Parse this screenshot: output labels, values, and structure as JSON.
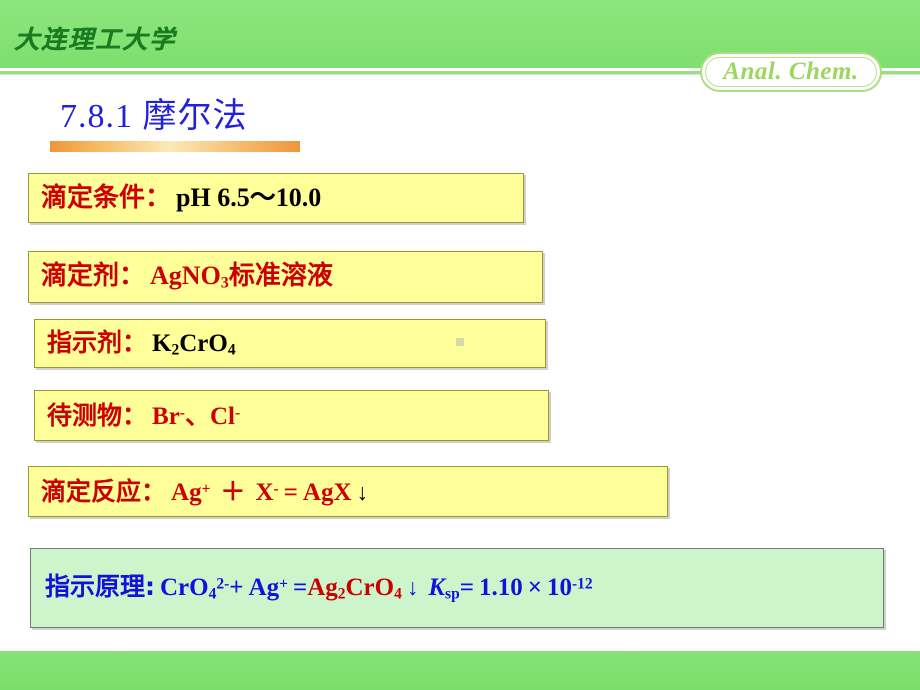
{
  "header": {
    "university_logo": "大连理工大学",
    "course_badge": "Anal. Chem.",
    "band_color": "#82e072",
    "logo_color": "#1a7a1f",
    "badge_color": "#9bd75f"
  },
  "title": {
    "number": "7.8.1",
    "text": "摩尔法",
    "full": "7.8.1 摩尔法",
    "color": "#2222d8",
    "underline_color": "#f0943c"
  },
  "boxes": [
    {
      "id": "titration-condition",
      "label": "滴定条件：",
      "label_color": "#cc0000",
      "value": "pH  6.5～10.0",
      "value_color": "#000000",
      "fill": "#ffff99",
      "border": "#999933"
    },
    {
      "id": "titrant",
      "label": "滴定剂：",
      "label_color": "#cc0000",
      "value_parts": {
        "formula_base": "AgNO",
        "formula_sub": "3",
        "suffix": "标准溶液"
      },
      "value_color": "#cc0000",
      "fill": "#ffff99",
      "border": "#999933"
    },
    {
      "id": "indicator",
      "label": "指示剂：",
      "label_color": "#cc0000",
      "value_parts": {
        "a": "K",
        "a_sub": "2",
        "b": "CrO",
        "b_sub": "4"
      },
      "value_color": "#000000",
      "fill": "#ffff99",
      "border": "#999933"
    },
    {
      "id": "analyte",
      "label": "待测物：",
      "label_color": "#cc0000",
      "value_parts": {
        "ion1": "Br",
        "ion1_sup": "-",
        "sep": "、",
        "ion2": "Cl",
        "ion2_sup": "-"
      },
      "value_color": "#cc0000",
      "fill": "#ffff99",
      "border": "#999933"
    },
    {
      "id": "titration-reaction",
      "label": "滴定反应：",
      "label_color": "#cc0000",
      "value_parts": {
        "ag": "Ag",
        "ag_sup": "+",
        "plus": "＋",
        "x": "X",
        "x_sup": "-",
        "eq": "=",
        "agx": "AgX",
        "arrow": "↓"
      },
      "value_color": "#cc0000",
      "fill": "#ffff99",
      "border": "#999933"
    },
    {
      "id": "indication-principle",
      "label": "指示原理:",
      "label_color": "#1111dd",
      "value_parts": {
        "cro4": "CrO",
        "cro4_sub": "4",
        "cro4_sup": "2-",
        "plus": "+",
        "ag": "Ag",
        "ag_sup": "+",
        "eq": "=",
        "product": "Ag",
        "product_sub": "2",
        "product_rest": "CrO",
        "product_rest_sub": "4",
        "arrow": "↓",
        "ksp_k": "K",
        "ksp_sub": "sp",
        "ksp_eq": "=",
        "ksp_value": "1.10",
        "times": "×",
        "base": "10",
        "exponent": "-12"
      },
      "fill": "#ccf5cc",
      "border": "#6f7f6f"
    }
  ],
  "footer": {
    "band_color": "#7ade6a"
  }
}
